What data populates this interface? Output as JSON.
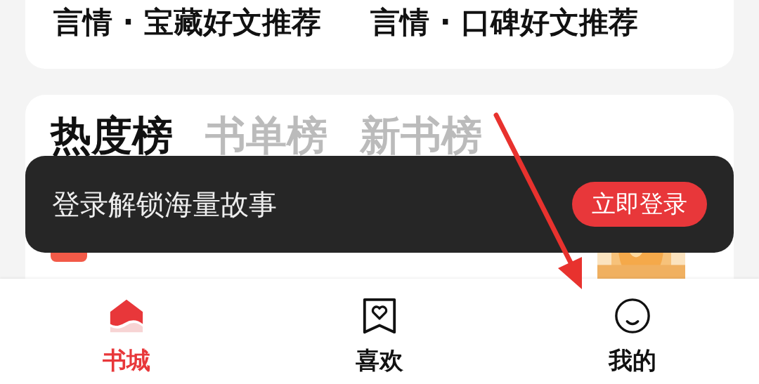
{
  "top_links": [
    "言情 · 宝藏好文推荐",
    "言情 · 口碑好文推荐"
  ],
  "ranking": {
    "tabs": [
      {
        "label": "热度榜",
        "selected": true
      },
      {
        "label": "书单榜",
        "selected": false
      },
      {
        "label": "新书榜",
        "selected": false
      }
    ]
  },
  "login_banner": {
    "message": "登录解锁海量故事",
    "button": "立即登录"
  },
  "bottom_nav": [
    {
      "kind": "home",
      "label": "书城",
      "selected": true
    },
    {
      "kind": "favorites",
      "label": "喜欢",
      "selected": false
    },
    {
      "kind": "profile",
      "label": "我的",
      "selected": false
    }
  ]
}
